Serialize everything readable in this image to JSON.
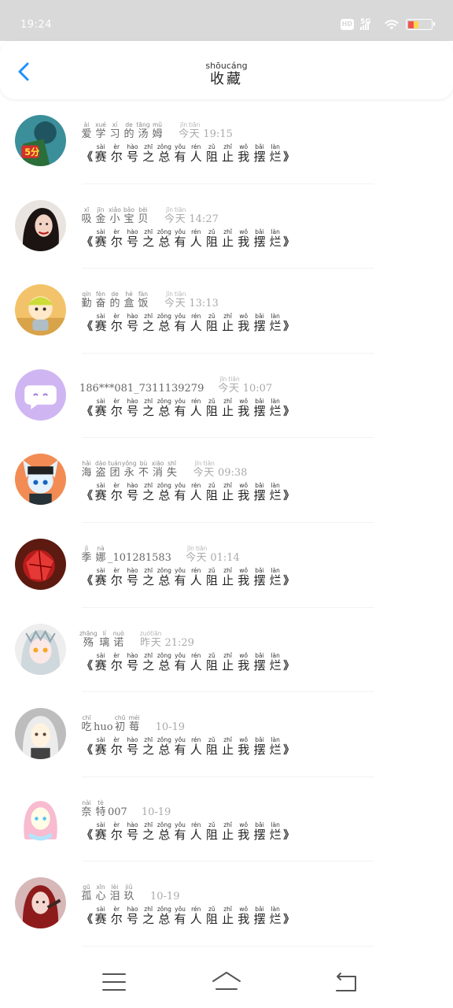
{
  "status_bar": {
    "time": "19:24",
    "hd_label": "HD",
    "network_label": "5G",
    "battery_colors": [
      "#ef5350",
      "#ffd54f",
      "#ffffff"
    ]
  },
  "header": {
    "title_pinyin": "shōucáng",
    "title": "收藏",
    "accent_color": "#1e90ff"
  },
  "message_ruby": [
    {
      "py": "sài",
      "hz": "赛"
    },
    {
      "py": "èr",
      "hz": "尔"
    },
    {
      "py": "hào",
      "hz": "号"
    },
    {
      "py": "zhī",
      "hz": "之"
    },
    {
      "py": "zǒng",
      "hz": "总"
    },
    {
      "py": "yǒu",
      "hz": "有"
    },
    {
      "py": "rén",
      "hz": "人"
    },
    {
      "py": "zǔ",
      "hz": "阻"
    },
    {
      "py": "zhǐ",
      "hz": "止"
    },
    {
      "py": "wǒ",
      "hz": "我"
    },
    {
      "py": "bǎi",
      "hz": "摆"
    },
    {
      "py": "làn",
      "hz": "烂"
    }
  ],
  "message_open": "《",
  "message_close": "》",
  "items": [
    {
      "avatar": "avatar-1",
      "nick": [
        {
          "py": "ài",
          "hz": "爱"
        },
        {
          "py": "xué",
          "hz": "学"
        },
        {
          "py": "xí",
          "hz": "习"
        },
        {
          "py": "de",
          "hz": "的"
        },
        {
          "py": "tāng",
          "hz": "汤"
        },
        {
          "py": "mǔ",
          "hz": "姆"
        }
      ],
      "time": [
        {
          "py": "jīn",
          "hz": "今"
        },
        {
          "py": "tiān",
          "hz": "天"
        }
      ],
      "time_text": "19:15"
    },
    {
      "avatar": "avatar-2",
      "nick": [
        {
          "py": "xī",
          "hz": "吸"
        },
        {
          "py": "jīn",
          "hz": "金"
        },
        {
          "py": "xiǎo",
          "hz": "小"
        },
        {
          "py": "bǎo",
          "hz": "宝"
        },
        {
          "py": "bèi",
          "hz": "贝"
        }
      ],
      "time": [
        {
          "py": "jīn",
          "hz": "今"
        },
        {
          "py": "tiān",
          "hz": "天"
        }
      ],
      "time_text": "14:27"
    },
    {
      "avatar": "avatar-3",
      "nick": [
        {
          "py": "qín",
          "hz": "勤"
        },
        {
          "py": "fèn",
          "hz": "奋"
        },
        {
          "py": "de",
          "hz": "的"
        },
        {
          "py": "hé",
          "hz": "盒"
        },
        {
          "py": "fàn",
          "hz": "饭"
        }
      ],
      "time": [
        {
          "py": "jīn",
          "hz": "今"
        },
        {
          "py": "tiān",
          "hz": "天"
        }
      ],
      "time_text": "13:13"
    },
    {
      "avatar": "avatar-4",
      "nick_plain": "186***081_7311139279",
      "time": [
        {
          "py": "jīn",
          "hz": "今"
        },
        {
          "py": "tiān",
          "hz": "天"
        }
      ],
      "time_text": "10:07"
    },
    {
      "avatar": "avatar-5",
      "nick": [
        {
          "py": "hǎi",
          "hz": "海"
        },
        {
          "py": "dào",
          "hz": "盗"
        },
        {
          "py": "tuán",
          "hz": "团"
        },
        {
          "py": "yǒng",
          "hz": "永"
        },
        {
          "py": "bù",
          "hz": "不"
        },
        {
          "py": "xiāo",
          "hz": "消"
        },
        {
          "py": "shī",
          "hz": "失"
        }
      ],
      "time": [
        {
          "py": "jīn",
          "hz": "今"
        },
        {
          "py": "tiān",
          "hz": "天"
        }
      ],
      "time_text": "09:38"
    },
    {
      "avatar": "avatar-6",
      "nick": [
        {
          "py": "jì",
          "hz": "季"
        },
        {
          "py": "nà",
          "hz": "娜"
        }
      ],
      "nick_suffix": "_101281583",
      "time": [
        {
          "py": "jīn",
          "hz": "今"
        },
        {
          "py": "tiān",
          "hz": "天"
        }
      ],
      "time_text": "01:14"
    },
    {
      "avatar": "avatar-7",
      "nick": [
        {
          "py": "zhāng",
          "hz": "殇"
        },
        {
          "py": "lí",
          "hz": "璃"
        },
        {
          "py": "nuò",
          "hz": "诺"
        }
      ],
      "time": [
        {
          "py": "zuó",
          "hz": "昨"
        },
        {
          "py": "tiān",
          "hz": "天"
        }
      ],
      "time_text": "21:29"
    },
    {
      "avatar": "avatar-8",
      "nick": [
        {
          "py": "chī",
          "hz": "吃"
        }
      ],
      "nick_mid": "huo",
      "nick2": [
        {
          "py": "chū",
          "hz": "初"
        },
        {
          "py": "méi",
          "hz": "莓"
        }
      ],
      "time": [],
      "time_text": "10-19"
    },
    {
      "avatar": "avatar-9",
      "nick": [
        {
          "py": "nài",
          "hz": "奈"
        },
        {
          "py": "tè",
          "hz": "特"
        }
      ],
      "nick_suffix": "007",
      "time": [],
      "time_text": "10-19"
    },
    {
      "avatar": "avatar-10",
      "nick": [
        {
          "py": "gū",
          "hz": "孤"
        },
        {
          "py": "xīn",
          "hz": "心"
        },
        {
          "py": "lèi",
          "hz": "泪"
        },
        {
          "py": "jiǔ",
          "hz": "玖"
        }
      ],
      "time": [],
      "time_text": "10-19"
    }
  ],
  "navbar": {
    "menu_icon": "menu-icon",
    "home_icon": "home-icon",
    "back_icon": "back-nav-icon"
  }
}
